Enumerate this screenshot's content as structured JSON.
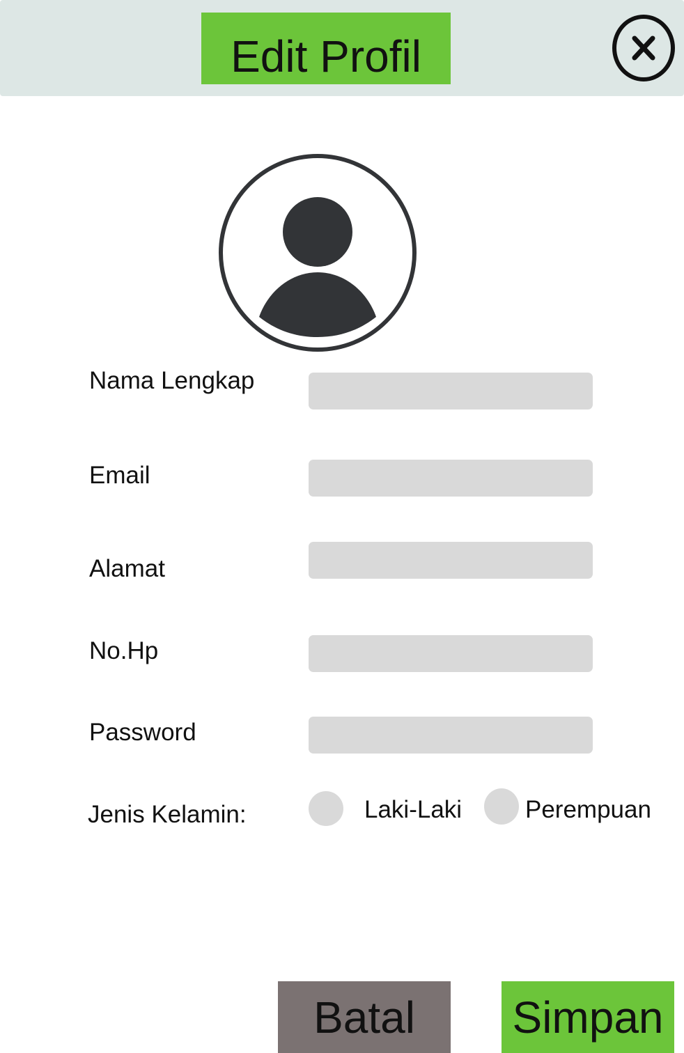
{
  "header": {
    "title": "Edit Profil",
    "close_icon": "close-circle-x-icon"
  },
  "avatar": {
    "icon": "user-avatar-icon"
  },
  "form": {
    "fields": [
      {
        "label": "Nama Lengkap",
        "value": ""
      },
      {
        "label": "Email",
        "value": ""
      },
      {
        "label": "Alamat",
        "value": ""
      },
      {
        "label": "No.Hp",
        "value": ""
      },
      {
        "label": "Password",
        "value": ""
      }
    ],
    "gender": {
      "label": "Jenis Kelamin:",
      "options": [
        "Laki-Laki",
        "Perempuan"
      ]
    }
  },
  "actions": {
    "cancel_label": "Batal",
    "save_label": "Simpan"
  },
  "colors": {
    "header_bg": "#dde7e5",
    "accent_green": "#6cc53a",
    "cancel_gray": "#7b7272",
    "input_bg": "#d9d9d9",
    "avatar_dark": "#323437"
  }
}
